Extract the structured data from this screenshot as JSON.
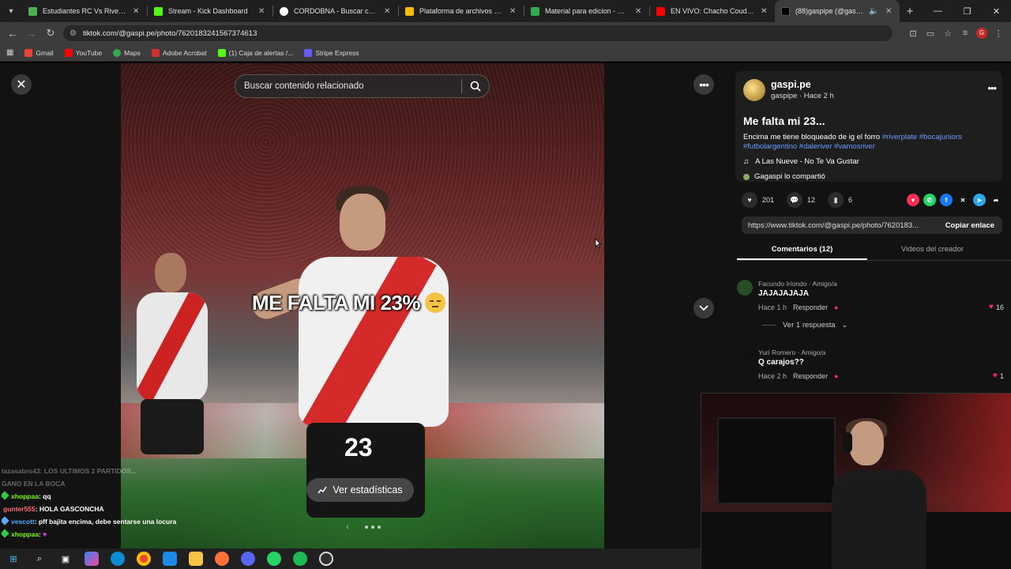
{
  "browser": {
    "tabs": [
      {
        "title": "Estudiantes RC Vs River Plate -",
        "color": "#4caf50"
      },
      {
        "title": "Stream - Kick Dashboard",
        "color": "#53fc18"
      },
      {
        "title": "CORDOBNA - Buscar con Goog",
        "color": "#ffffff"
      },
      {
        "title": "Plataforma de archivos compa",
        "color": "#fbbc04"
      },
      {
        "title": "Material para edicion - Google",
        "color": "#34a853"
      },
      {
        "title": "EN VIVO: Chacho Coudet habl",
        "color": "#ff0000"
      },
      {
        "title": "(88)gaspipe (@gaspi.pe) | Ti",
        "color": "#000000"
      }
    ],
    "url": "tiktok.com/@gaspi.pe/photo/7620183241567374613",
    "bookmarks": [
      {
        "label": "Gmail",
        "color": "#ea4335"
      },
      {
        "label": "YouTube",
        "color": "#ff0000"
      },
      {
        "label": "Maps",
        "color": "#34a853"
      },
      {
        "label": "Adobe Acrobat",
        "color": "#d32f2f"
      },
      {
        "label": "(1) Caja de alertas /...",
        "color": "#53fc18"
      },
      {
        "label": "Stripe Express",
        "color": "#635bff"
      }
    ]
  },
  "viewer": {
    "search_placeholder": "Buscar contenido relacionado",
    "overlay_text": "ME FALTA MI 23%",
    "jersey_number": "23",
    "stats_label": "Ver estadísticas"
  },
  "chat": [
    {
      "user": "lazasabro43",
      "text": ": LOS ULTIMOS 2 PARTIDOS...",
      "faded": true,
      "user_color": "#7d6aa8"
    },
    {
      "user": "",
      "text": "GANO EN LA BOCA",
      "faded": true,
      "user_color": "#ffffff"
    },
    {
      "user": "xhoppaa",
      "text": ": qq",
      "faded": false,
      "user_color": "#7cfc00"
    },
    {
      "user": "gunter555",
      "text": ": HOLA GASCONCHA",
      "faded": false,
      "user_color": "#ff6b6b"
    },
    {
      "user": "vescott",
      "text": ": pff bajita encima, debe sentarse una locura",
      "faded": false,
      "user_color": "#5aa9ff"
    },
    {
      "user": "xhoppaa",
      "text": ": ",
      "faded": false,
      "user_color": "#7cfc00"
    }
  ],
  "post": {
    "display_name": "gaspi.pe",
    "username": "gaspipe",
    "time": "Hace 2 h",
    "title": "Me falta mi 23...",
    "description": "Encima me tiene bloqueado de ig el forro",
    "hashtags": [
      "#riverplate",
      "#bocajuniors",
      "#futbolargentino",
      "#daleriver",
      "#vamosriver"
    ],
    "music": "A Las Nueve - No Te Va Gustar",
    "shared_by": "Gagaspi lo compartió",
    "likes": "201",
    "comments_count": "12",
    "saves": "6",
    "link": "https://www.tiktok.com/@gaspi.pe/photo/7620183...",
    "copy_label": "Copiar enlace",
    "tab_comments": "Comentarios (12)",
    "tab_videos": "Videos del creador"
  },
  "comments": [
    {
      "author": "Facundo Iriondo · Amigo/a",
      "text": "JAJAJAJAJA",
      "time": "Hace 1 h",
      "reply": "Responder",
      "likes": "16",
      "replies": "Ver 1 respuesta"
    },
    {
      "author": "Yuri Romero · Amigo/a",
      "text": "Q carajos??",
      "time": "Hace 2 h",
      "reply": "Responder",
      "likes": "1"
    }
  ]
}
